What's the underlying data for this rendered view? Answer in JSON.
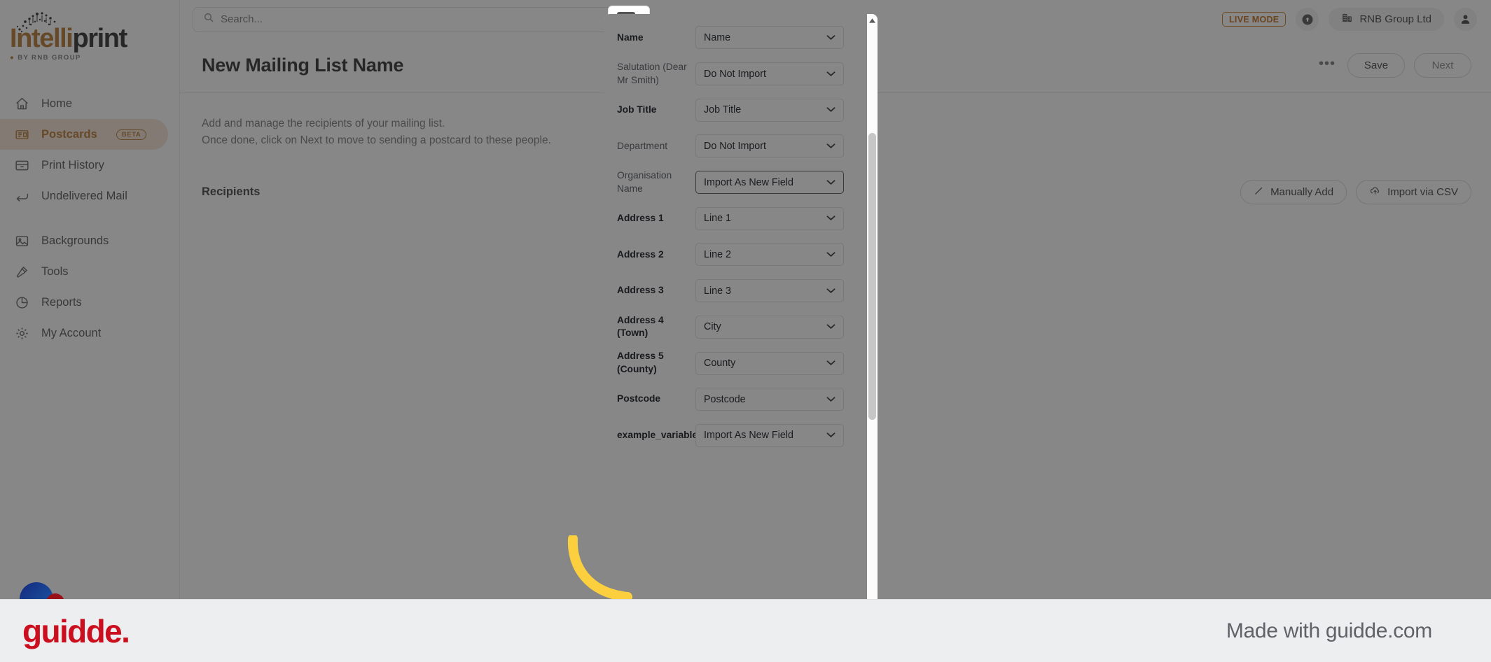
{
  "brand": {
    "logo_primary": "Intelli",
    "logo_secondary": "print",
    "logo_tagline": "BY RNB GROUP",
    "accent_color": "#c08a4d"
  },
  "topbar": {
    "search_placeholder": "Search...",
    "search_value": "",
    "live_mode_label": "LIVE MODE",
    "organisation": "RNB Group Ltd"
  },
  "sidebar": {
    "items": [
      {
        "label": "Home",
        "icon": "home-icon",
        "active": false
      },
      {
        "label": "Postcards",
        "icon": "postcards-icon",
        "active": true,
        "badge": "BETA"
      },
      {
        "label": "Print History",
        "icon": "archive-icon",
        "active": false
      },
      {
        "label": "Undelivered Mail",
        "icon": "return-arrow-icon",
        "active": false
      },
      {
        "label": "Backgrounds",
        "icon": "image-icon",
        "active": false
      },
      {
        "label": "Tools",
        "icon": "hammer-icon",
        "active": false
      },
      {
        "label": "Reports",
        "icon": "pie-chart-icon",
        "active": false
      },
      {
        "label": "My Account",
        "icon": "gear-icon",
        "active": false
      }
    ]
  },
  "page": {
    "title": "New Mailing List Name",
    "actions": {
      "more_label": "•••",
      "save_label": "Save",
      "next_label": "Next"
    },
    "description_line_1": "Add and manage the recipients of your mailing list.",
    "description_line_2": "Once done, click on Next to move to sending a postcard to these people.",
    "section_title": "Recipients",
    "section_actions": {
      "manually_add_label": "Manually Add",
      "import_csv_label": "Import via CSV"
    }
  },
  "modal": {
    "rows": [
      {
        "label": "Name",
        "value": "Name",
        "mapped": true,
        "focused": false
      },
      {
        "label": "Salutation (Dear Mr Smith)",
        "value": "Do Not Import",
        "mapped": false,
        "focused": false
      },
      {
        "label": "Job Title",
        "value": "Job Title",
        "mapped": true,
        "focused": false
      },
      {
        "label": "Department",
        "value": "Do Not Import",
        "mapped": false,
        "focused": false
      },
      {
        "label": "Organisation Name",
        "value": "Import As New Field",
        "mapped": false,
        "focused": true
      },
      {
        "label": "Address 1",
        "value": "Line 1",
        "mapped": true,
        "focused": false
      },
      {
        "label": "Address 2",
        "value": "Line 2",
        "mapped": true,
        "focused": false
      },
      {
        "label": "Address 3",
        "value": "Line 3",
        "mapped": true,
        "focused": false
      },
      {
        "label": "Address 4 (Town)",
        "value": "City",
        "mapped": true,
        "focused": false
      },
      {
        "label": "Address 5 (County)",
        "value": "County",
        "mapped": true,
        "focused": false
      },
      {
        "label": "Postcode",
        "value": "Postcode",
        "mapped": true,
        "focused": false
      },
      {
        "label": "example_variable",
        "value": "Import As New Field",
        "mapped": true,
        "focused": false
      }
    ]
  },
  "footer": {
    "logo": "guidde.",
    "made_with": "Made with guidde.com",
    "logo_color": "#cc0f1f"
  }
}
